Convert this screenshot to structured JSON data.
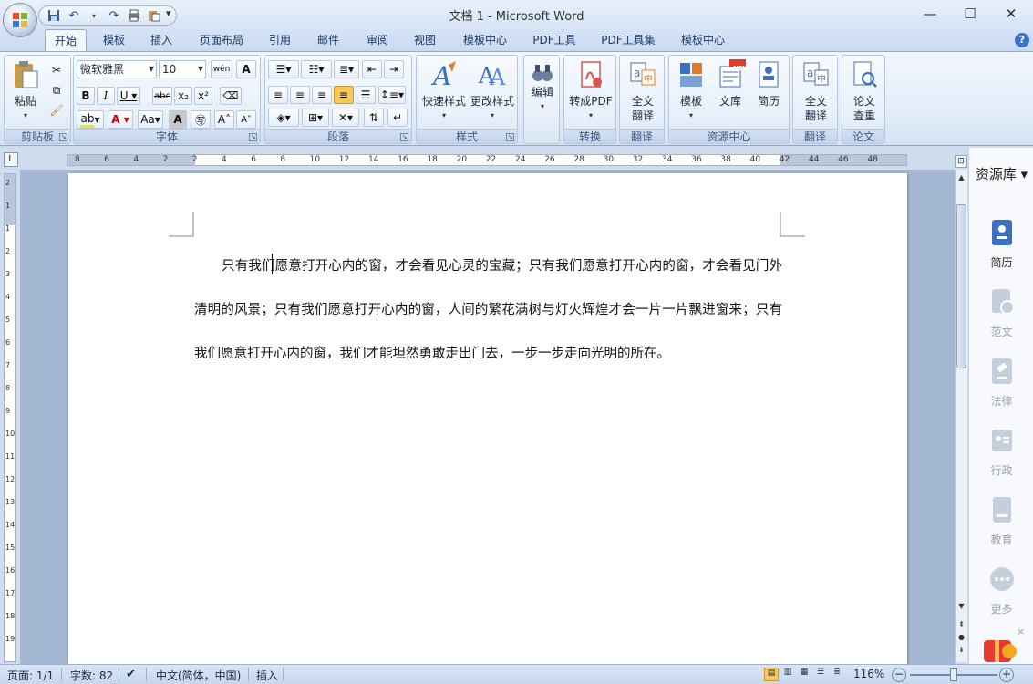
{
  "window": {
    "title": "文档 1 - Microsoft Word"
  },
  "tabs": [
    "开始",
    "模板",
    "插入",
    "页面布局",
    "引用",
    "邮件",
    "审阅",
    "视图",
    "模板中心",
    "PDF工具",
    "PDF工具集",
    "模板中心"
  ],
  "active_tab": "开始",
  "ribbon": {
    "clipboard": {
      "paste": "粘贴",
      "label": "剪贴板"
    },
    "font": {
      "name": "微软雅黑",
      "size": "10",
      "label": "字体",
      "wen": "wén",
      "aa": "Aa"
    },
    "paragraph": {
      "label": "段落"
    },
    "styles": {
      "quick": "快速样式",
      "change": "更改样式",
      "label": "样式"
    },
    "edit": {
      "label": "编辑"
    },
    "convert": {
      "pdf": "转成PDF",
      "label": "转换"
    },
    "translate1": {
      "btn_line1": "全文",
      "btn_line2": "翻译",
      "label": "翻译"
    },
    "resources": {
      "template": "模板",
      "library": "文库",
      "resume": "简历",
      "new_badge": "NEW",
      "label": "资源中心"
    },
    "translate2": {
      "btn_line1": "全文",
      "btn_line2": "翻译",
      "label": "翻译"
    },
    "paper": {
      "btn_line1": "论文",
      "btn_line2": "查重",
      "label": "论文"
    }
  },
  "ruler": {
    "numbers": [
      "8",
      "6",
      "4",
      "2",
      "2",
      "4",
      "6",
      "8",
      "10",
      "12",
      "14",
      "16",
      "18",
      "20",
      "22",
      "24",
      "26",
      "28",
      "30",
      "32",
      "34",
      "36",
      "38",
      "40",
      "42",
      "44",
      "46",
      "48"
    ]
  },
  "document": {
    "paragraph": "只有我们愿意打开心内的窗，才会看见心灵的宝藏；只有我们愿意打开心内的窗，才会看见门外清明的风景；只有我们愿意打开心内的窗，人间的繁花满树与灯火辉煌才会一片一片飘进窗来；只有我们愿意打开心内的窗，我们才能坦然勇敢走出门去，一步一步走向光明的所在。"
  },
  "side_panel": {
    "title": "资源库",
    "items": [
      "简历",
      "范文",
      "法律",
      "行政",
      "教育",
      "更多"
    ]
  },
  "status": {
    "page": "页面: 1/1",
    "words": "字数: 82",
    "language": "中文(简体，中国)",
    "mode": "插入",
    "zoom": "116%"
  },
  "colors": {
    "accent": "#3c6fc0",
    "ribbon_bg": "#e4edf9"
  }
}
